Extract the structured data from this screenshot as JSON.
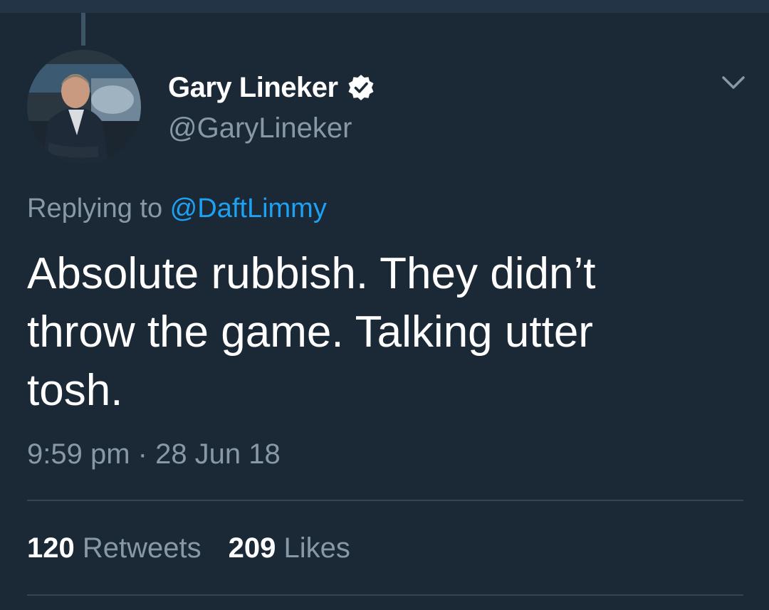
{
  "user": {
    "display_name": "Gary Lineker",
    "handle": "@GaryLineker",
    "verified": true
  },
  "tweet": {
    "replying_prefix": "Replying to ",
    "replying_to": "@DaftLimmy",
    "text": "Absolute rubbish. They didn’t throw the game. Talking utter tosh.",
    "time": "9:59 pm · 28 Jun 18"
  },
  "stats": {
    "retweets_count": "120",
    "retweets_label": "Retweets",
    "likes_count": "209",
    "likes_label": "Likes"
  },
  "icons": {
    "verified": "verified-badge-icon",
    "more": "chevron-down-icon"
  },
  "colors": {
    "background": "#1b2836",
    "accent": "#1da1f2",
    "secondary_text": "#8899a6"
  }
}
